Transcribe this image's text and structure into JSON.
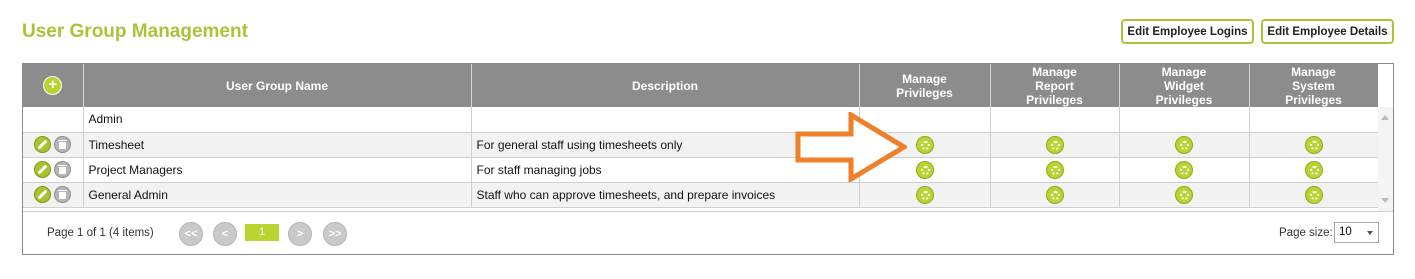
{
  "page": {
    "title": "User Group Management"
  },
  "toolbar": {
    "edit_logins": "Edit Employee Logins",
    "edit_details": "Edit Employee Details"
  },
  "grid": {
    "headers": {
      "name": "User Group Name",
      "description": "Description",
      "privileges": "Manage\nPrivileges",
      "report": "Manage\nReport\nPrivileges",
      "widget": "Manage\nWidget\nPrivileges",
      "system": "Manage\nSystem\nPrivileges"
    },
    "rows": [
      {
        "name": "Admin",
        "description": ""
      },
      {
        "name": "Timesheet",
        "description": "For general staff using timesheets only"
      },
      {
        "name": "Project Managers",
        "description": "For staff managing jobs"
      },
      {
        "name": "General Admin",
        "description": "Staff who can approve timesheets, and prepare invoices"
      }
    ]
  },
  "pager": {
    "info": "Page 1 of 1 (4 items)",
    "first": "<<",
    "prev": "<",
    "current": "1",
    "next": ">",
    "last": ">>",
    "size_label": "Page size:",
    "size_value": "10"
  },
  "icons": {
    "add": "add-icon",
    "edit": "edit-icon",
    "delete": "delete-icon",
    "privileges": "gear-icon",
    "annotation": "arrow-annotation"
  },
  "colors": {
    "accent": "#a8c53a",
    "header_bg": "#8c8c8c",
    "arrow": "#f07f2a"
  }
}
